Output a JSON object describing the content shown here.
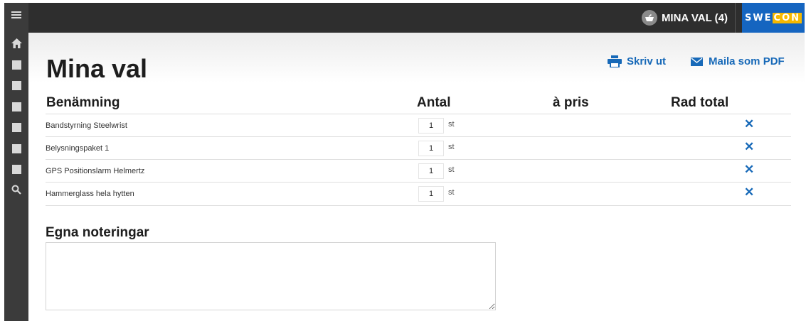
{
  "topbar": {
    "cart_label": "MINA VAL (4)",
    "logo_part1": "SWE",
    "logo_part2": "CON",
    "brand_color": "#1565c0",
    "accent_color": "#f5b800"
  },
  "sidebar": {
    "icons": [
      "hamburger-icon",
      "home-icon",
      "square-icon",
      "square-icon",
      "square-icon",
      "square-icon",
      "square-icon",
      "square-icon",
      "search-icon"
    ]
  },
  "page": {
    "title": "Mina val",
    "print_label": "Skriv ut",
    "email_label": "Maila som PDF"
  },
  "table": {
    "columns": [
      "Benämning",
      "Antal",
      "à pris",
      "Rad total"
    ],
    "rows": [
      {
        "name": "Bandstyrning Steelwrist",
        "qty": "1",
        "unit": "st"
      },
      {
        "name": "Belysningspaket 1",
        "qty": "1",
        "unit": "st"
      },
      {
        "name": "GPS Positionslarm Helmertz",
        "qty": "1",
        "unit": "st"
      },
      {
        "name": "Hammerglass hela hytten",
        "qty": "1",
        "unit": "st"
      }
    ]
  },
  "notes": {
    "title": "Egna noteringar",
    "value": ""
  }
}
